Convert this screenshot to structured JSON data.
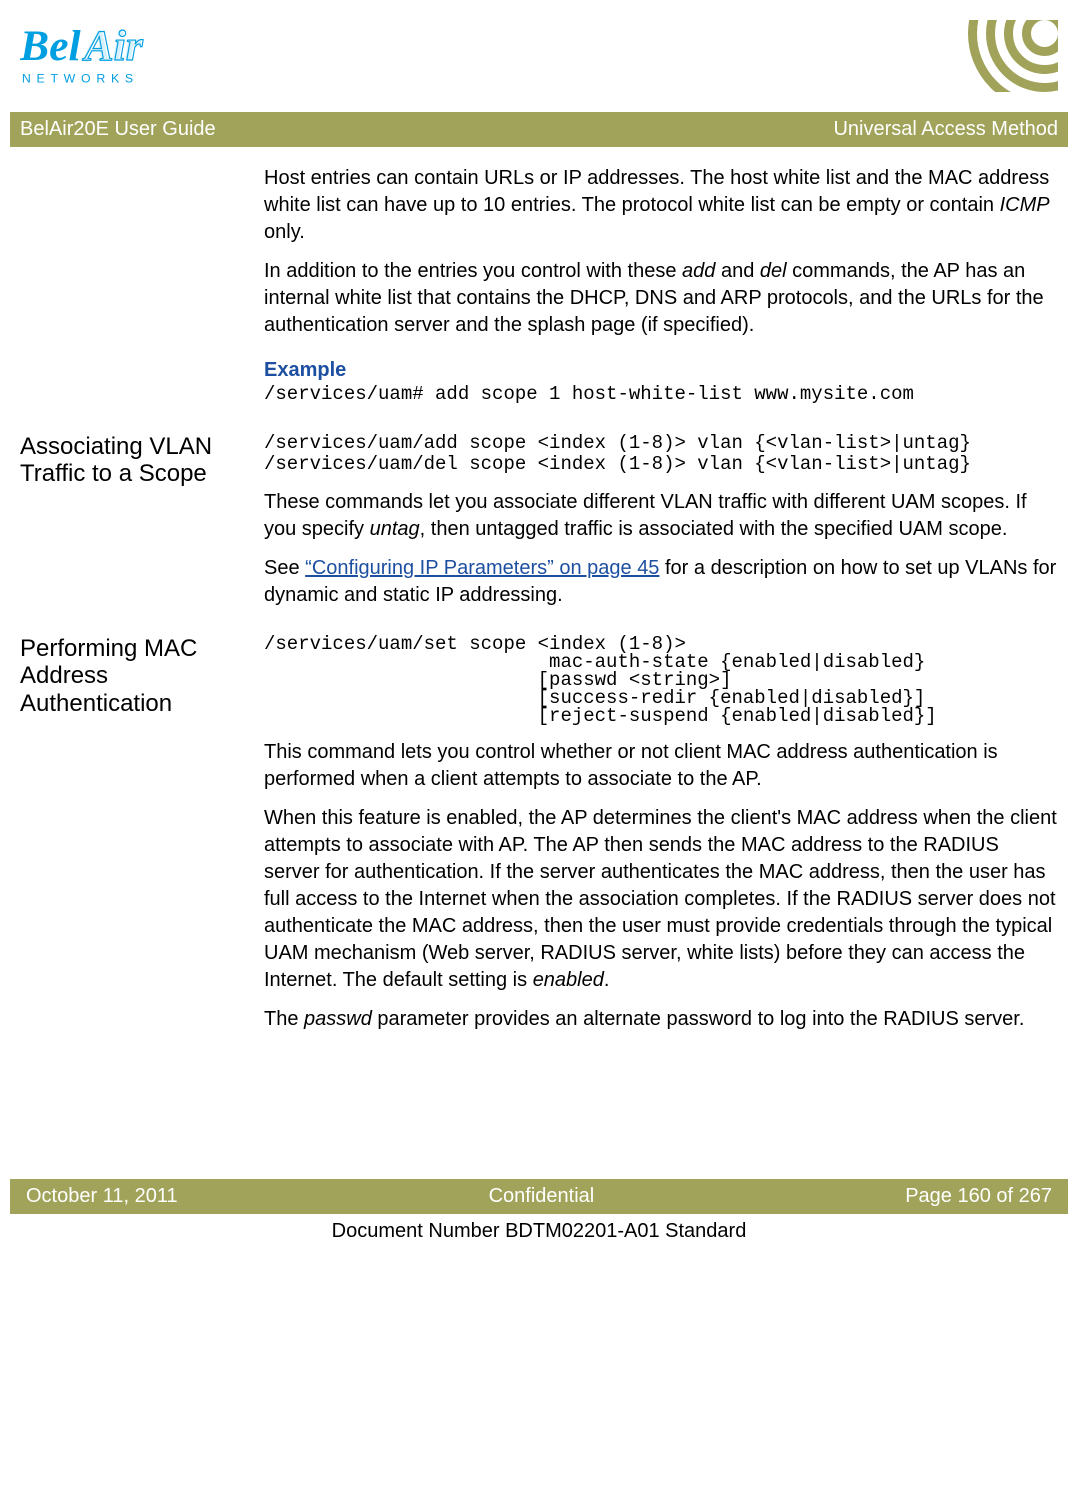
{
  "logo": {
    "brand_1": "Bel",
    "brand_2": "Air",
    "sub": "NETWORKS"
  },
  "header": {
    "left": "BelAir20E User Guide",
    "right": "Universal Access Method"
  },
  "sections": {
    "intro": {
      "p1a": "Host entries can contain URLs or IP addresses. The host white list and the MAC address white list can have up to 10 entries. The protocol white list can be empty or contain ",
      "p1b": "ICMP",
      "p1c": " only.",
      "p2a": "In addition to the entries you control with these ",
      "p2b": "add",
      "p2c": " and ",
      "p2d": "del",
      "p2e": " commands, the AP has an internal white list that contains the DHCP, DNS and ARP protocols, and the URLs for the authentication server and the splash page (if specified).",
      "example_label": "Example",
      "example_code": "/services/uam# add scope 1 host-white-list www.mysite.com"
    },
    "vlan": {
      "heading": "Associating VLAN Traffic to a Scope",
      "code": "/services/uam/add scope <index (1-8)> vlan {<vlan-list>|untag}\n/services/uam/del scope <index (1-8)> vlan {<vlan-list>|untag}",
      "p1a": "These commands let you associate different VLAN traffic with different UAM scopes. If you specify ",
      "p1b": "untag",
      "p1c": ", then untagged traffic is associated with the specified UAM scope.",
      "p2a": "See ",
      "p2link": "“Configuring IP Parameters” on page 45",
      "p2b": " for a description on how to set up VLANs for dynamic and static IP addressing."
    },
    "mac": {
      "heading": "Performing MAC Address Authentication",
      "code": "/services/uam/set scope <index (1-8)>\n                         mac-auth-state {enabled|disabled}\n                        [passwd <string>]\n                        [success-redir {enabled|disabled}]\n                        [reject-suspend {enabled|disabled}]",
      "p1": "This command lets you control whether or not client MAC address authentication is performed when a client attempts to associate to the AP.",
      "p2a": "When this feature is enabled, the AP determines the client's MAC address when the client attempts to associate with AP. The AP then sends the MAC address to the RADIUS server for authentication. If the server authenticates the MAC address, then the user has full access to the Internet when the association completes. If the RADIUS server does not authenticate the MAC address, then the user must provide credentials through the typical UAM mechanism (Web server, RADIUS server, white lists) before they can access the Internet. The default setting is ",
      "p2b": "enabled",
      "p2c": ".",
      "p3a": "The ",
      "p3b": "passwd",
      "p3c": " parameter provides an alternate password to log into the RADIUS server."
    }
  },
  "footer": {
    "left": "October 11, 2011",
    "center": "Confidential",
    "right": "Page 160 of 267",
    "docnum": "Document Number BDTM02201-A01 Standard"
  }
}
